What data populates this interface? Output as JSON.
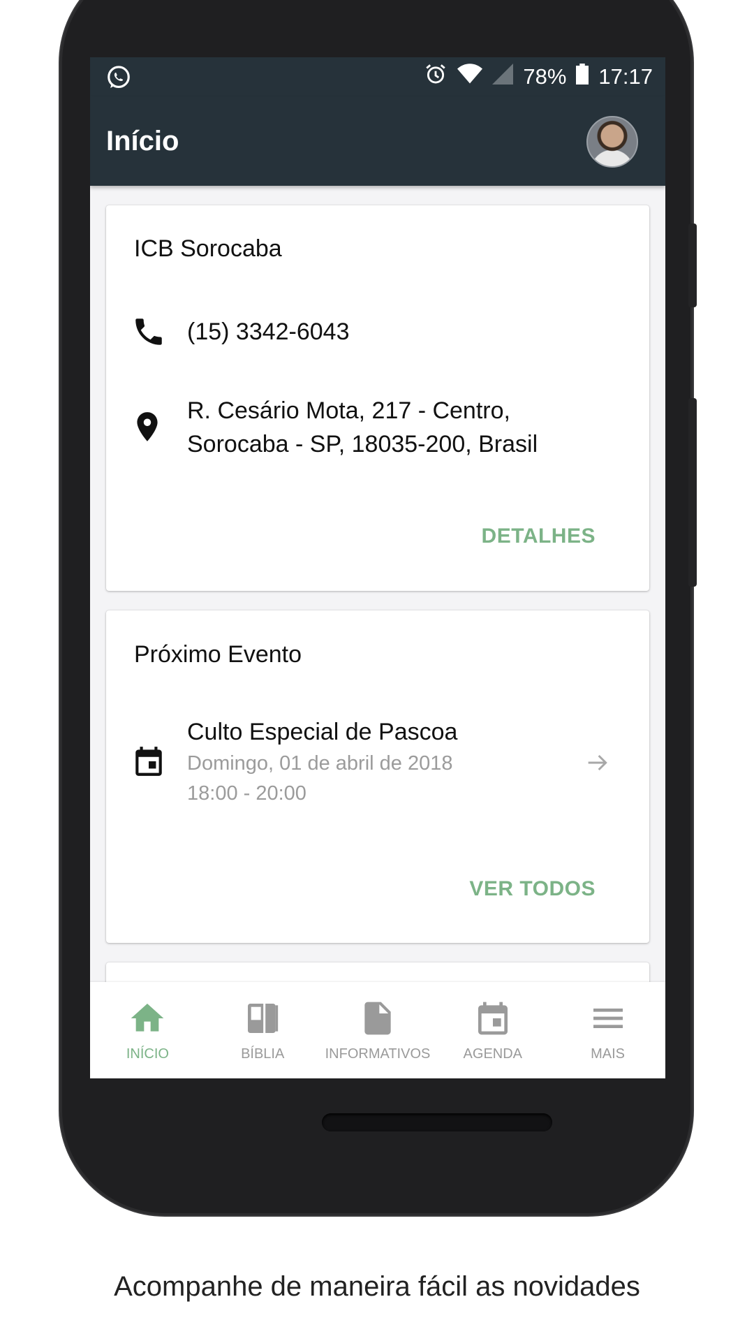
{
  "status_bar": {
    "battery": "78%",
    "time": "17:17"
  },
  "app_bar": {
    "title": "Início"
  },
  "church_card": {
    "name": "ICB Sorocaba",
    "phone": "(15) 3342-6043",
    "address_line1": "R. Cesário Mota, 217 - Centro,",
    "address_line2": "Sorocaba - SP, 18035-200, Brasil",
    "action": "DETALHES"
  },
  "event_card": {
    "title": "Próximo Evento",
    "event_name": "Culto Especial de Pascoa",
    "event_date": "Domingo, 01 de abril de 2018",
    "event_time": "18:00 - 20:00",
    "action": "VER TODOS"
  },
  "bottom_nav": {
    "items": [
      {
        "label": "INÍCIO",
        "icon": "home-icon",
        "active": true
      },
      {
        "label": "BÍBLIA",
        "icon": "book-icon",
        "active": false
      },
      {
        "label": "INFORMATIVOS",
        "icon": "document-icon",
        "active": false
      },
      {
        "label": "AGENDA",
        "icon": "calendar-icon",
        "active": false
      },
      {
        "label": "MAIS",
        "icon": "menu-icon",
        "active": false
      }
    ]
  },
  "caption": "Acompanhe de maneira fácil as novidades",
  "colors": {
    "primary_dark": "#26323a",
    "accent": "#7cb387",
    "inactive": "#9a9a9a"
  }
}
